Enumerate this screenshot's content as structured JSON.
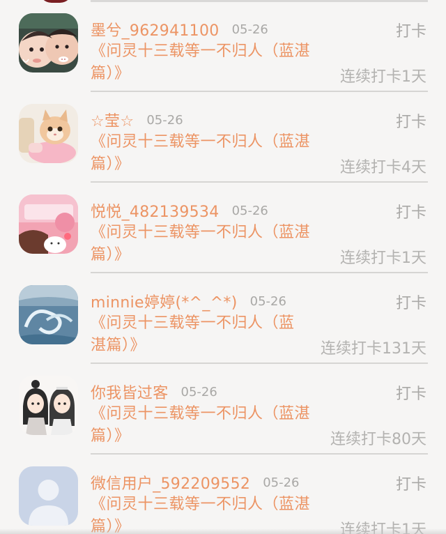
{
  "feed": {
    "items": [
      {
        "nickname": "墨兮_962941100",
        "date": "05-26",
        "checkin_label": "打卡",
        "book_title": "《问灵十三载等一不归人（蓝湛篇）》",
        "streak": "连续打卡1天",
        "avatar_icon": "baby-photo-avatar"
      },
      {
        "nickname": "☆莹☆",
        "date": "05-26",
        "checkin_label": "打卡",
        "book_title": "《问灵十三载等一不归人（蓝湛篇）》",
        "streak": "连续打卡4天",
        "avatar_icon": "kitten-photo-avatar"
      },
      {
        "nickname": "悦悦_482139534",
        "date": "05-26",
        "checkin_label": "打卡",
        "book_title": "《问灵十三载等一不归人（蓝湛篇）》",
        "streak": "连续打卡1天",
        "avatar_icon": "pink-cartoon-avatar"
      },
      {
        "nickname": "minnie婷婷(*^_^*)",
        "date": "05-26",
        "checkin_label": "打卡",
        "book_title": "《问灵十三载等一不归人（蓝湛篇）》",
        "streak": "连续打卡131天",
        "avatar_icon": "ocean-wave-avatar"
      },
      {
        "nickname": "你我皆过客",
        "date": "05-26",
        "checkin_label": "打卡",
        "book_title": "《问灵十三载等一不归人（蓝湛篇）》",
        "streak": "连续打卡80天",
        "avatar_icon": "anime-duo-avatar"
      },
      {
        "nickname": "微信用户_592209552",
        "date": "05-26",
        "checkin_label": "打卡",
        "book_title": "《问灵十三载等一不归人（蓝湛篇）》",
        "streak": "连续打卡1天",
        "avatar_icon": "default-user-avatar"
      }
    ]
  },
  "colors": {
    "nickname": "#ec9464",
    "muted": "#a9a8a6",
    "background": "#f6f5f4",
    "divider": "#d6d5d3"
  }
}
